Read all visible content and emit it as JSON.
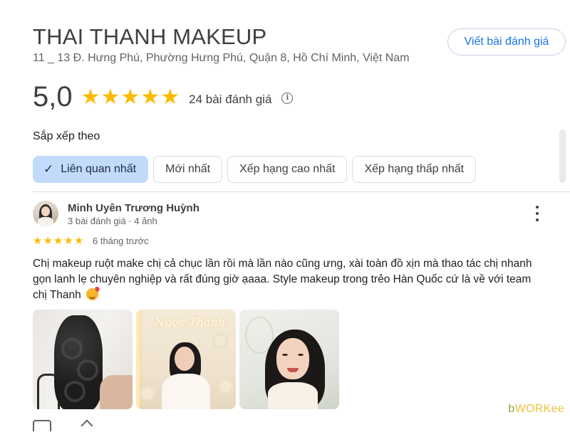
{
  "place": {
    "name": "THAI THANH MAKEUP",
    "address": "11 _ 13 Đ. Hưng Phú, Phường Hưng Phú, Quận 8, Hồ Chí Minh, Việt Nam",
    "write_review_label": "Viết bài đánh giá",
    "rating": "5,0",
    "stars_filled": 5,
    "review_count": "24 bài đánh giá",
    "info_icon": "info-icon"
  },
  "sort": {
    "label": "Sắp xếp theo",
    "options": [
      {
        "label": "Liên quan nhất",
        "selected": true
      },
      {
        "label": "Mới nhất",
        "selected": false
      },
      {
        "label": "Xếp hạng cao nhất",
        "selected": false
      },
      {
        "label": "Xếp hạng thấp nhất",
        "selected": false
      }
    ]
  },
  "review": {
    "author": "Minh Uyên Trương Huỳnh",
    "meta": "3 bài đánh giá · 4 ảnh",
    "stars": 5,
    "time": "6 tháng trước",
    "text": "Chị makeup ruột make chị cả chục lần rồi mà lần nào cũng ưng, xài toàn đồ xịn mà thao tác chị nhanh gọn lanh lẹ chuyên nghiệp và rất đúng giờ ạaaa. Style makeup trong trẻo Hàn Quốc cứ là về với team chị Thanh",
    "emoji": "smiling-face-with-hearts",
    "photos": [
      "hair-curls-photo",
      "bride-neon-sign-photo",
      "makeup-portrait-photo"
    ],
    "photo2_neon_text": "Ngọc Thanh"
  },
  "watermark": {
    "prefix": "b",
    "text": "WORKee"
  },
  "colors": {
    "star": "#fbbc04",
    "accent_blue": "#1a73e8",
    "chip_selected_bg": "#c2dbfb"
  }
}
